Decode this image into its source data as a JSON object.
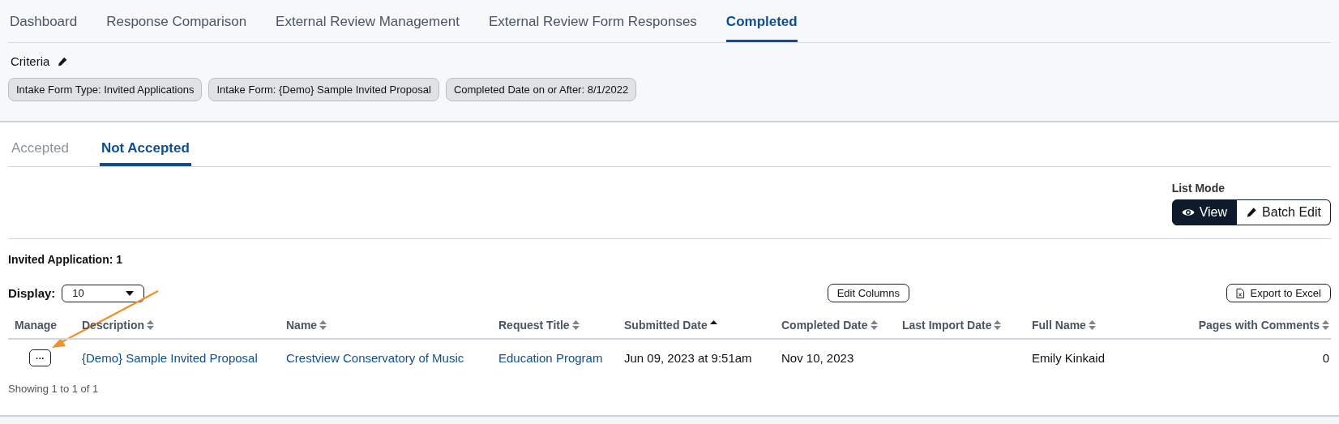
{
  "tabs": [
    {
      "label": "Dashboard",
      "selected": false
    },
    {
      "label": "Response Comparison",
      "selected": false
    },
    {
      "label": "External Review Management",
      "selected": false
    },
    {
      "label": "External Review Form Responses",
      "selected": false
    },
    {
      "label": "Completed",
      "selected": true
    }
  ],
  "criteria": {
    "label": "Criteria",
    "chips": [
      "Intake Form Type: Invited Applications",
      "Intake Form: {Demo} Sample Invited Proposal",
      "Completed Date on or After: 8/1/2022"
    ]
  },
  "subtabs": [
    {
      "label": "Accepted",
      "selected": false
    },
    {
      "label": "Not Accepted",
      "selected": true
    }
  ],
  "list_mode": {
    "label": "List Mode",
    "options": [
      {
        "label": "View",
        "selected": true
      },
      {
        "label": "Batch Edit",
        "selected": false
      }
    ]
  },
  "count_label": "Invited Application: 1",
  "display": {
    "label": "Display:",
    "value": "10"
  },
  "edit_columns": "Edit Columns",
  "export": "Export to Excel",
  "table": {
    "columns": [
      {
        "label": "Manage"
      },
      {
        "label": "Description",
        "sorted_ascending": false
      },
      {
        "label": "Name",
        "sorted_ascending": false
      },
      {
        "label": "Request Title",
        "sorted_ascending": false
      },
      {
        "label": "Submitted Date",
        "sorted_ascending": true
      },
      {
        "label": "Completed Date",
        "sorted_ascending": false
      },
      {
        "label": "Last Import Date",
        "sorted_ascending": false
      },
      {
        "label": "Full Name",
        "sorted_ascending": false
      },
      {
        "label": "Pages with Comments",
        "sorted_ascending": false
      }
    ],
    "rows": [
      {
        "manage": "···",
        "description": "{Demo} Sample Invited Proposal",
        "name": "Crestview Conservatory of Music",
        "request_title": "Education Program",
        "submitted": "Jun 09, 2023 at 9:51am",
        "completed": "Nov 10, 2023",
        "full_name": "Emily Kinkaid",
        "pages_with_comments": "0"
      }
    ]
  },
  "footer": "Showing 1 to 1 of 1"
}
